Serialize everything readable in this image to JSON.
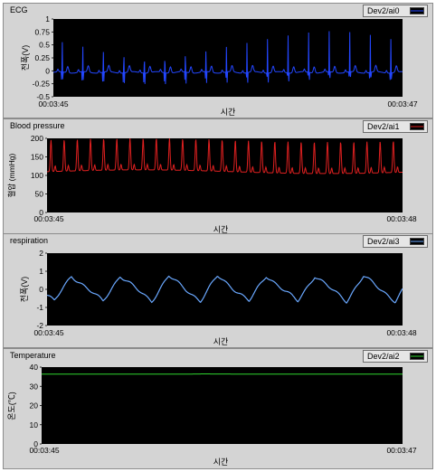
{
  "panels": [
    {
      "id": "ecg",
      "title": "ECG",
      "channel": "Dev2/ai0",
      "color": "#2346ff",
      "ylabel": "전폭(V)",
      "xlabel": "시간",
      "x_start": "00:03:45",
      "x_end": "00:03:47",
      "yticks": [
        "1",
        "0.75",
        "0.5",
        "0.25",
        "0",
        "-0.25",
        "-0.5"
      ],
      "ylim": [
        -0.5,
        1
      ],
      "signal": "ecg"
    },
    {
      "id": "blood-pressure",
      "title": "Blood pressure",
      "channel": "Dev2/ai1",
      "color": "#e02020",
      "ylabel": "혈압 (mmHg)",
      "xlabel": "시간",
      "x_start": "00:03:45",
      "x_end": "00:03:48",
      "yticks": [
        "200",
        "150",
        "100",
        "50",
        "0"
      ],
      "ylim": [
        0,
        200
      ],
      "signal": "bp"
    },
    {
      "id": "respiration",
      "title": "respiration",
      "channel": "Dev2/ai3",
      "color": "#6aa8ff",
      "ylabel": "전폭(V)",
      "xlabel": "시간",
      "x_start": "00:03:45",
      "x_end": "00:03:48",
      "yticks": [
        "2",
        "1",
        "0",
        "-1",
        "-2"
      ],
      "ylim": [
        -2,
        2
      ],
      "signal": "resp"
    },
    {
      "id": "temperature",
      "title": "Temperature",
      "channel": "Dev2/ai2",
      "color": "#2fd62f",
      "ylabel": "온도(℃)",
      "xlabel": "시간",
      "x_start": "00:03:45",
      "x_end": "00:03:47",
      "yticks": [
        "40",
        "30",
        "20",
        "10",
        "0"
      ],
      "ylim": [
        0,
        40
      ],
      "signal": "temp"
    }
  ]
}
